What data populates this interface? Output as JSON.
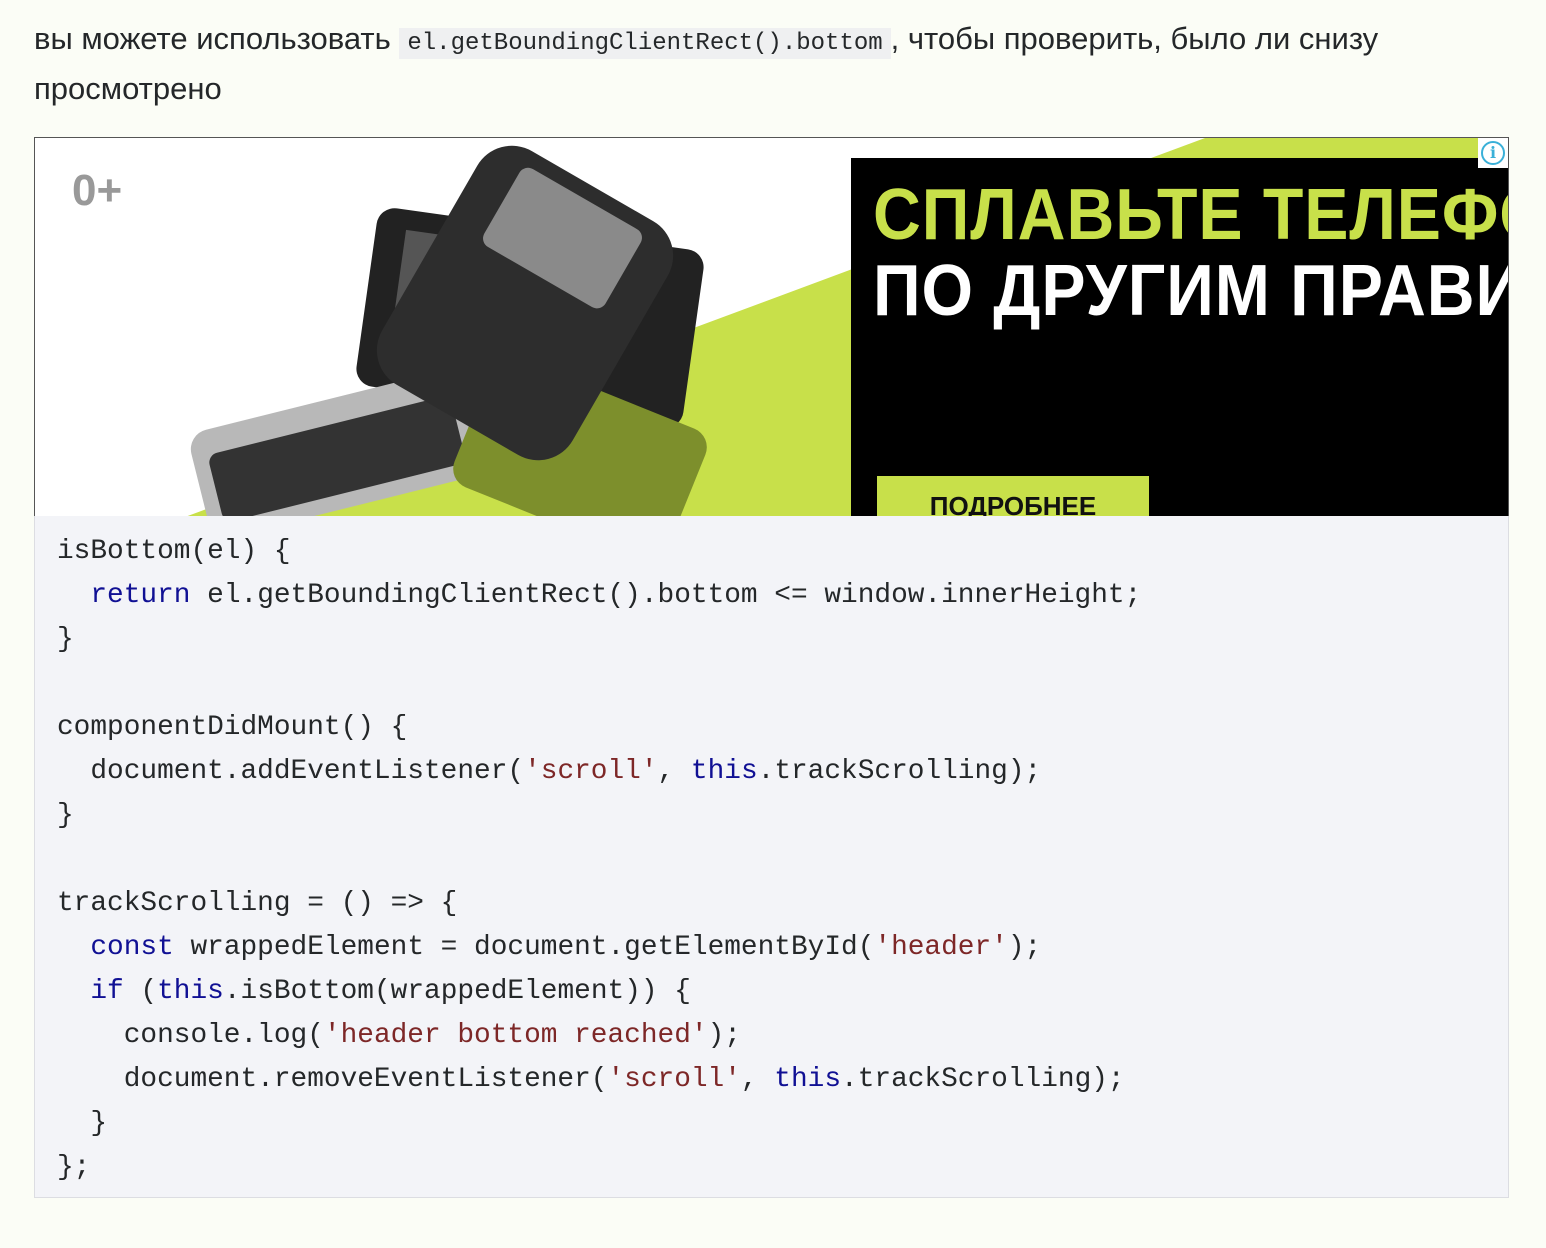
{
  "answer": {
    "text_before": "вы можете использовать ",
    "inline_code": "el.getBoundingClientRect().bottom",
    "text_after": ", чтобы проверить, было ли снизу просмотрено"
  },
  "ad": {
    "age_rating": "0+",
    "headline_1": "СПЛАВЬТЕ ТЕЛЕФО",
    "headline_2": "ПО ДРУГИМ ПРАВИ",
    "cta": "ПОДРОБНЕЕ",
    "info_icon": "info-icon",
    "colors": {
      "accent": "#c8e04a",
      "panel": "#000000"
    }
  },
  "code": {
    "lines": [
      [
        [
          "p",
          "isBottom(el) {"
        ]
      ],
      [
        [
          "p",
          "  "
        ],
        [
          "kw",
          "return"
        ],
        [
          "p",
          " el.getBoundingClientRect().bottom <= window.innerHeight;"
        ]
      ],
      [
        [
          "p",
          "}"
        ]
      ],
      [
        [
          "p",
          ""
        ]
      ],
      [
        [
          "p",
          "componentDidMount() {"
        ]
      ],
      [
        [
          "p",
          "  document.addEventListener("
        ],
        [
          "str",
          "'scroll'"
        ],
        [
          "p",
          ", "
        ],
        [
          "kw",
          "this"
        ],
        [
          "p",
          ".trackScrolling);"
        ]
      ],
      [
        [
          "p",
          "}"
        ]
      ],
      [
        [
          "p",
          ""
        ]
      ],
      [
        [
          "p",
          "trackScrolling = () => {"
        ]
      ],
      [
        [
          "p",
          "  "
        ],
        [
          "kw",
          "const"
        ],
        [
          "p",
          " wrappedElement = document.getElementById("
        ],
        [
          "str",
          "'header'"
        ],
        [
          "p",
          ");"
        ]
      ],
      [
        [
          "p",
          "  "
        ],
        [
          "kw",
          "if"
        ],
        [
          "p",
          " ("
        ],
        [
          "kw",
          "this"
        ],
        [
          "p",
          ".isBottom(wrappedElement)) {"
        ]
      ],
      [
        [
          "p",
          "    console.log("
        ],
        [
          "str",
          "'header bottom reached'"
        ],
        [
          "p",
          ");"
        ]
      ],
      [
        [
          "p",
          "    document.removeEventListener("
        ],
        [
          "str",
          "'scroll'"
        ],
        [
          "p",
          ", "
        ],
        [
          "kw",
          "this"
        ],
        [
          "p",
          ".trackScrolling);"
        ]
      ],
      [
        [
          "p",
          "  }"
        ]
      ],
      [
        [
          "p",
          "};"
        ]
      ]
    ]
  }
}
